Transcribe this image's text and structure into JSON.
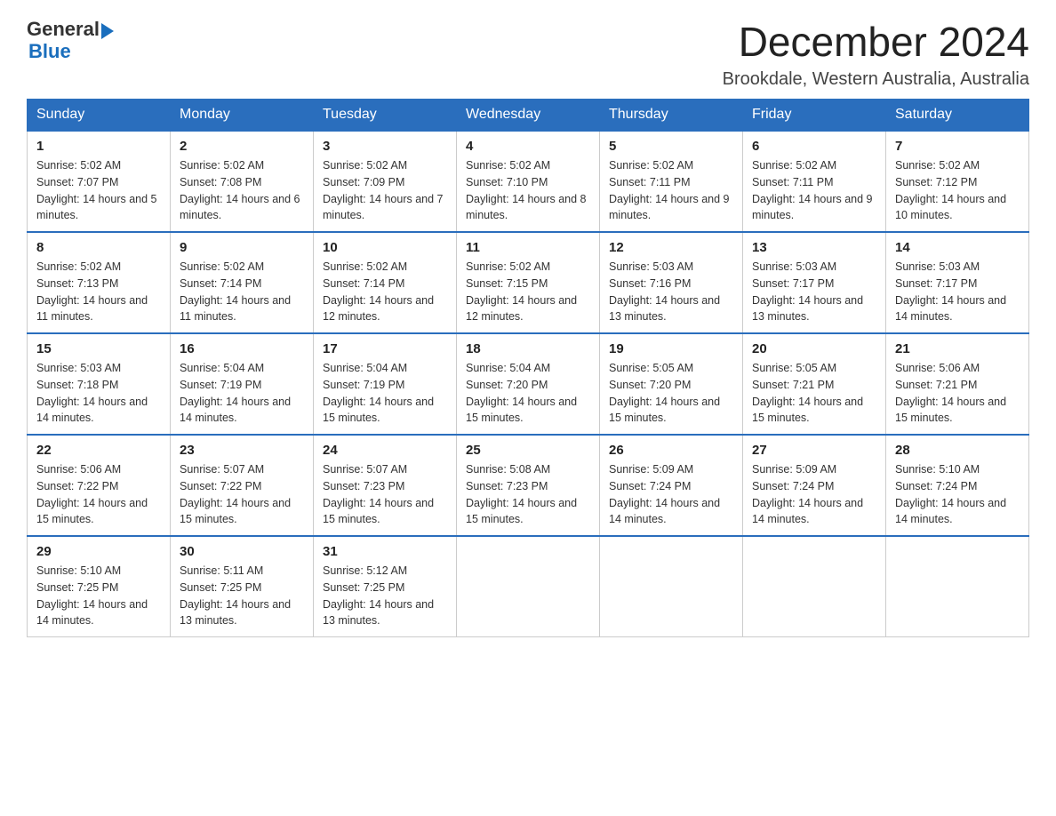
{
  "header": {
    "logo_general": "General",
    "logo_blue": "Blue",
    "title": "December 2024",
    "subtitle": "Brookdale, Western Australia, Australia"
  },
  "weekdays": [
    "Sunday",
    "Monday",
    "Tuesday",
    "Wednesday",
    "Thursday",
    "Friday",
    "Saturday"
  ],
  "weeks": [
    [
      {
        "day": "1",
        "sunrise": "Sunrise: 5:02 AM",
        "sunset": "Sunset: 7:07 PM",
        "daylight": "Daylight: 14 hours and 5 minutes."
      },
      {
        "day": "2",
        "sunrise": "Sunrise: 5:02 AM",
        "sunset": "Sunset: 7:08 PM",
        "daylight": "Daylight: 14 hours and 6 minutes."
      },
      {
        "day": "3",
        "sunrise": "Sunrise: 5:02 AM",
        "sunset": "Sunset: 7:09 PM",
        "daylight": "Daylight: 14 hours and 7 minutes."
      },
      {
        "day": "4",
        "sunrise": "Sunrise: 5:02 AM",
        "sunset": "Sunset: 7:10 PM",
        "daylight": "Daylight: 14 hours and 8 minutes."
      },
      {
        "day": "5",
        "sunrise": "Sunrise: 5:02 AM",
        "sunset": "Sunset: 7:11 PM",
        "daylight": "Daylight: 14 hours and 9 minutes."
      },
      {
        "day": "6",
        "sunrise": "Sunrise: 5:02 AM",
        "sunset": "Sunset: 7:11 PM",
        "daylight": "Daylight: 14 hours and 9 minutes."
      },
      {
        "day": "7",
        "sunrise": "Sunrise: 5:02 AM",
        "sunset": "Sunset: 7:12 PM",
        "daylight": "Daylight: 14 hours and 10 minutes."
      }
    ],
    [
      {
        "day": "8",
        "sunrise": "Sunrise: 5:02 AM",
        "sunset": "Sunset: 7:13 PM",
        "daylight": "Daylight: 14 hours and 11 minutes."
      },
      {
        "day": "9",
        "sunrise": "Sunrise: 5:02 AM",
        "sunset": "Sunset: 7:14 PM",
        "daylight": "Daylight: 14 hours and 11 minutes."
      },
      {
        "day": "10",
        "sunrise": "Sunrise: 5:02 AM",
        "sunset": "Sunset: 7:14 PM",
        "daylight": "Daylight: 14 hours and 12 minutes."
      },
      {
        "day": "11",
        "sunrise": "Sunrise: 5:02 AM",
        "sunset": "Sunset: 7:15 PM",
        "daylight": "Daylight: 14 hours and 12 minutes."
      },
      {
        "day": "12",
        "sunrise": "Sunrise: 5:03 AM",
        "sunset": "Sunset: 7:16 PM",
        "daylight": "Daylight: 14 hours and 13 minutes."
      },
      {
        "day": "13",
        "sunrise": "Sunrise: 5:03 AM",
        "sunset": "Sunset: 7:17 PM",
        "daylight": "Daylight: 14 hours and 13 minutes."
      },
      {
        "day": "14",
        "sunrise": "Sunrise: 5:03 AM",
        "sunset": "Sunset: 7:17 PM",
        "daylight": "Daylight: 14 hours and 14 minutes."
      }
    ],
    [
      {
        "day": "15",
        "sunrise": "Sunrise: 5:03 AM",
        "sunset": "Sunset: 7:18 PM",
        "daylight": "Daylight: 14 hours and 14 minutes."
      },
      {
        "day": "16",
        "sunrise": "Sunrise: 5:04 AM",
        "sunset": "Sunset: 7:19 PM",
        "daylight": "Daylight: 14 hours and 14 minutes."
      },
      {
        "day": "17",
        "sunrise": "Sunrise: 5:04 AM",
        "sunset": "Sunset: 7:19 PM",
        "daylight": "Daylight: 14 hours and 15 minutes."
      },
      {
        "day": "18",
        "sunrise": "Sunrise: 5:04 AM",
        "sunset": "Sunset: 7:20 PM",
        "daylight": "Daylight: 14 hours and 15 minutes."
      },
      {
        "day": "19",
        "sunrise": "Sunrise: 5:05 AM",
        "sunset": "Sunset: 7:20 PM",
        "daylight": "Daylight: 14 hours and 15 minutes."
      },
      {
        "day": "20",
        "sunrise": "Sunrise: 5:05 AM",
        "sunset": "Sunset: 7:21 PM",
        "daylight": "Daylight: 14 hours and 15 minutes."
      },
      {
        "day": "21",
        "sunrise": "Sunrise: 5:06 AM",
        "sunset": "Sunset: 7:21 PM",
        "daylight": "Daylight: 14 hours and 15 minutes."
      }
    ],
    [
      {
        "day": "22",
        "sunrise": "Sunrise: 5:06 AM",
        "sunset": "Sunset: 7:22 PM",
        "daylight": "Daylight: 14 hours and 15 minutes."
      },
      {
        "day": "23",
        "sunrise": "Sunrise: 5:07 AM",
        "sunset": "Sunset: 7:22 PM",
        "daylight": "Daylight: 14 hours and 15 minutes."
      },
      {
        "day": "24",
        "sunrise": "Sunrise: 5:07 AM",
        "sunset": "Sunset: 7:23 PM",
        "daylight": "Daylight: 14 hours and 15 minutes."
      },
      {
        "day": "25",
        "sunrise": "Sunrise: 5:08 AM",
        "sunset": "Sunset: 7:23 PM",
        "daylight": "Daylight: 14 hours and 15 minutes."
      },
      {
        "day": "26",
        "sunrise": "Sunrise: 5:09 AM",
        "sunset": "Sunset: 7:24 PM",
        "daylight": "Daylight: 14 hours and 14 minutes."
      },
      {
        "day": "27",
        "sunrise": "Sunrise: 5:09 AM",
        "sunset": "Sunset: 7:24 PM",
        "daylight": "Daylight: 14 hours and 14 minutes."
      },
      {
        "day": "28",
        "sunrise": "Sunrise: 5:10 AM",
        "sunset": "Sunset: 7:24 PM",
        "daylight": "Daylight: 14 hours and 14 minutes."
      }
    ],
    [
      {
        "day": "29",
        "sunrise": "Sunrise: 5:10 AM",
        "sunset": "Sunset: 7:25 PM",
        "daylight": "Daylight: 14 hours and 14 minutes."
      },
      {
        "day": "30",
        "sunrise": "Sunrise: 5:11 AM",
        "sunset": "Sunset: 7:25 PM",
        "daylight": "Daylight: 14 hours and 13 minutes."
      },
      {
        "day": "31",
        "sunrise": "Sunrise: 5:12 AM",
        "sunset": "Sunset: 7:25 PM",
        "daylight": "Daylight: 14 hours and 13 minutes."
      },
      null,
      null,
      null,
      null
    ]
  ]
}
